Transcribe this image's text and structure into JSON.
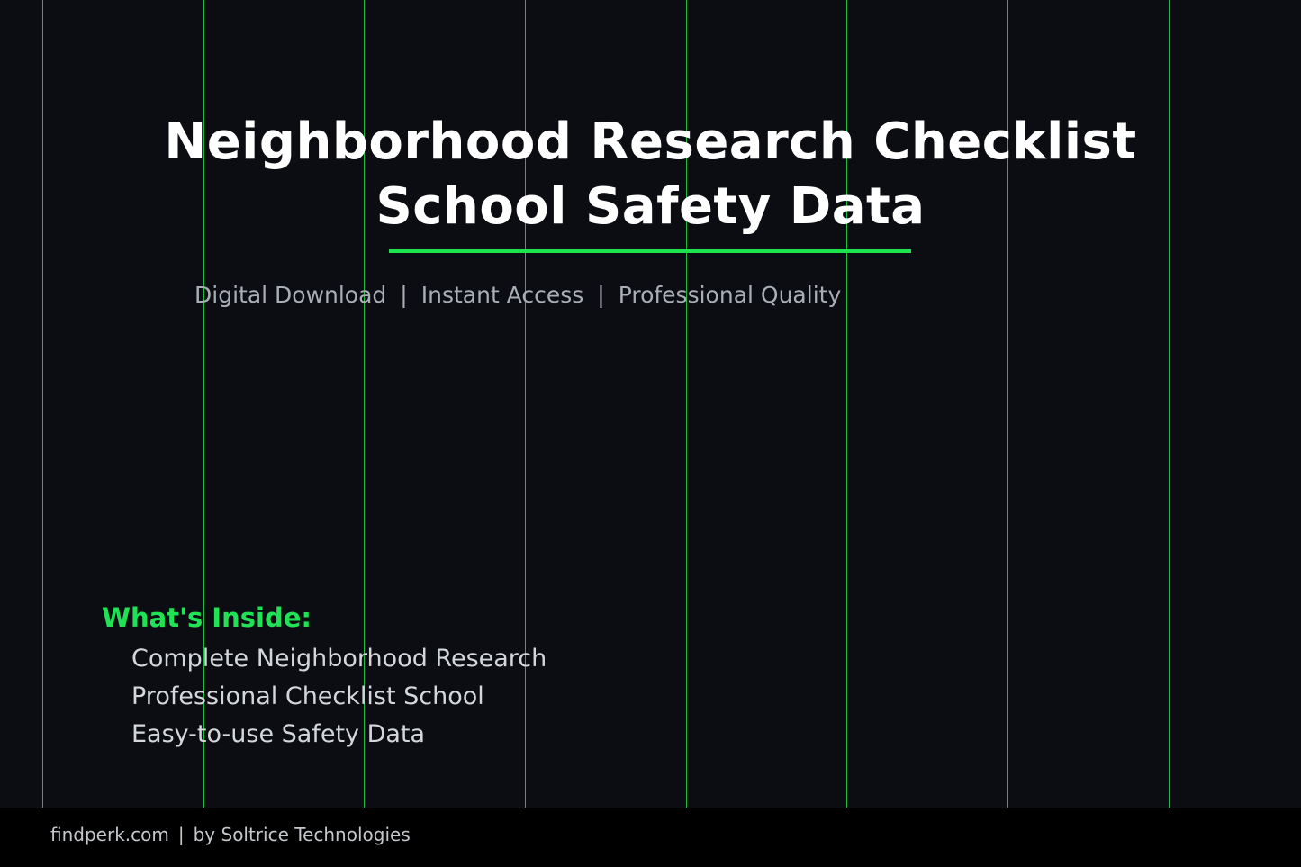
{
  "title": {
    "line1": "Neighborhood Research Checklist",
    "line2": "School Safety Data"
  },
  "features": {
    "items": [
      "Digital Download",
      "Instant Access",
      "Professional Quality"
    ],
    "separator": "|"
  },
  "inside": {
    "heading": "What's Inside:",
    "items": [
      "Complete Neighborhood Research",
      "Professional Checklist School",
      "Easy-to-use Safety Data"
    ]
  },
  "footer": {
    "site": "findperk.com",
    "separator": "|",
    "credit": "by Soltrice Technologies"
  },
  "colors": {
    "background": "#0b0d12",
    "accent": "#1fe254",
    "title": "#ffffff",
    "muted_text": "#a9aeb5",
    "footer_background": "#000000"
  }
}
